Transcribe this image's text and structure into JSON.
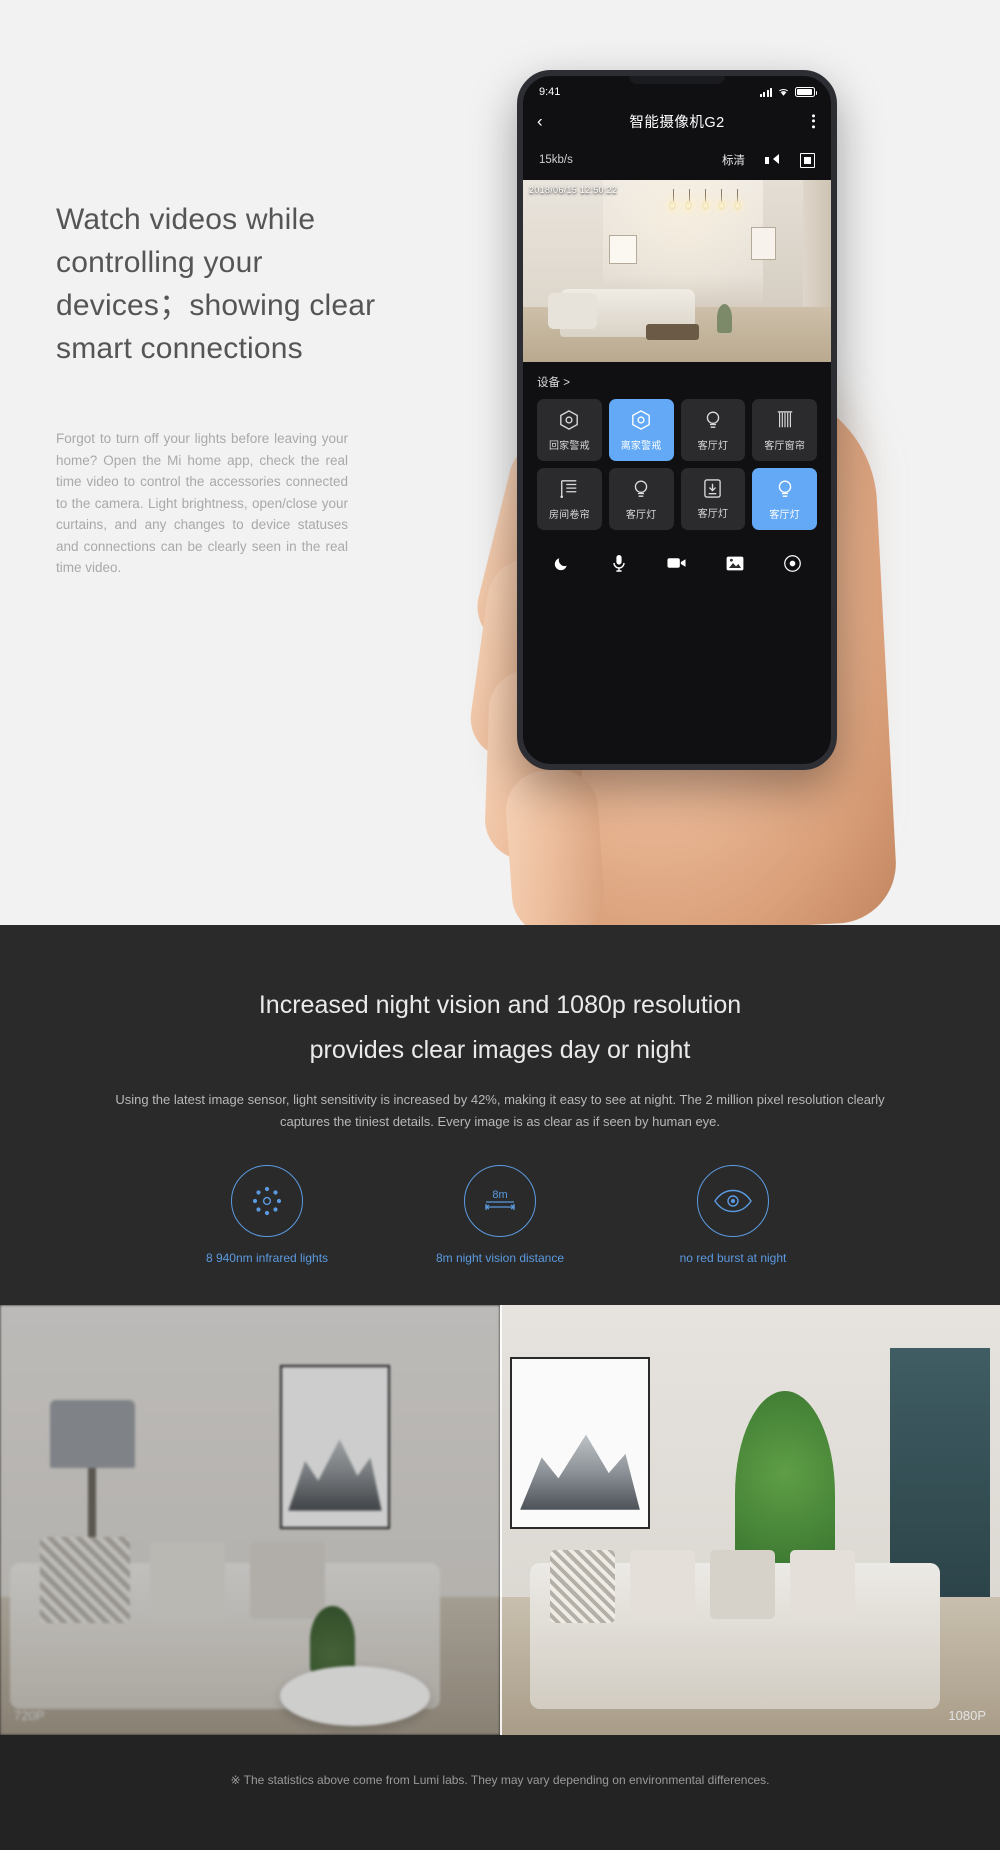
{
  "section1": {
    "headline": "Watch videos while controlling your devices；showing clear smart connections",
    "body": "Forgot to turn off your lights before leaving your home? Open the Mi home app, check the real time video to control the accessories connected to the camera. Light brightness, open/close your curtains, and any changes to device statuses  and connections can be clearly seen in the real time video.",
    "phone": {
      "status_time": "9:41",
      "nav_title": "智能摄像机G2",
      "back_icon": "chevron-left-icon",
      "more_icon": "more-vertical-icon",
      "bitrate": "15kb/s",
      "quality": "标清",
      "speaker_icon": "speaker-icon",
      "fullscreen_icon": "expand-icon",
      "video_timestamp": "2018/06/15 12:50:22",
      "devices_header": "设备 >",
      "tiles": [
        {
          "label": "回家警戒",
          "icon": "shield-hex-icon",
          "active": false
        },
        {
          "label": "离家警戒",
          "icon": "shield-hex-icon",
          "active": true
        },
        {
          "label": "客厅灯",
          "icon": "bulb-icon",
          "active": false
        },
        {
          "label": "客厅窗帘",
          "icon": "curtain-icon",
          "active": false
        },
        {
          "label": "房间卷帘",
          "icon": "blinds-icon",
          "active": false
        },
        {
          "label": "客厅灯",
          "icon": "bulb-icon",
          "active": false
        },
        {
          "label": "客厅灯",
          "icon": "download-box-icon",
          "active": false
        },
        {
          "label": "客厅灯",
          "icon": "bulb-icon",
          "active": true
        }
      ],
      "bottom_actions": [
        {
          "icon": "moon-icon"
        },
        {
          "icon": "microphone-icon"
        },
        {
          "icon": "video-camera-icon"
        },
        {
          "icon": "photo-icon"
        },
        {
          "icon": "record-dot-icon"
        }
      ]
    }
  },
  "section2": {
    "title_line1": "Increased night vision and 1080p resolution",
    "title_line2": "provides clear images day or night",
    "subtitle": "Using the latest image sensor, light sensitivity is increased by 42%, making it easy to see at night. The 2 million pixel resolution clearly captures the tiniest details. Every image is as clear as if seen by human eye.",
    "accent_color": "#5b9ae0",
    "features": [
      {
        "label": "8 940nm infrared lights",
        "icon": "ir-led-ring-icon",
        "value": ""
      },
      {
        "label": "8m night vision distance",
        "icon": "distance-icon",
        "value": "8m"
      },
      {
        "label": "no red burst at night",
        "icon": "eye-icon",
        "value": ""
      }
    ]
  },
  "section3": {
    "left_tag": "720P",
    "right_tag": "1080P"
  },
  "footer": {
    "footnote": "※ The statistics above come from Lumi labs. They may vary depending on environmental differences."
  }
}
